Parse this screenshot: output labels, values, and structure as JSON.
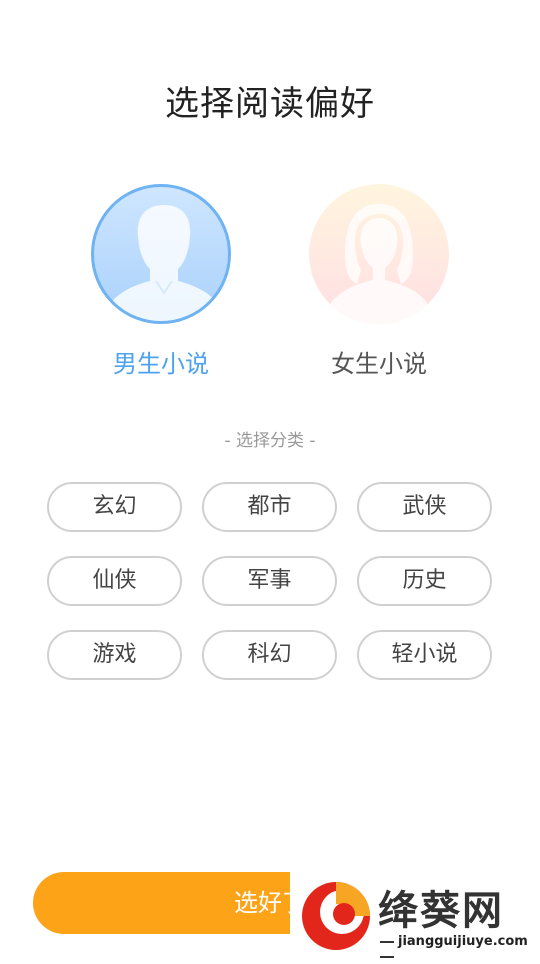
{
  "header": {
    "title": "选择阅读偏好"
  },
  "genders": [
    {
      "label": "男生小说",
      "selected": true
    },
    {
      "label": "女生小说",
      "selected": false
    }
  ],
  "categories": {
    "caption": "- 选择分类 -",
    "items": [
      "玄幻",
      "都市",
      "武侠",
      "仙侠",
      "军事",
      "历史",
      "游戏",
      "科幻",
      "轻小说"
    ]
  },
  "confirm": {
    "label": "选好了"
  },
  "watermark": {
    "name": "绛葵网",
    "url": "jiangguijiuye.com"
  },
  "colors": {
    "accent_blue": "#4ea2ef",
    "button_orange": "#fca318",
    "chip_border": "#d0d0d0"
  }
}
